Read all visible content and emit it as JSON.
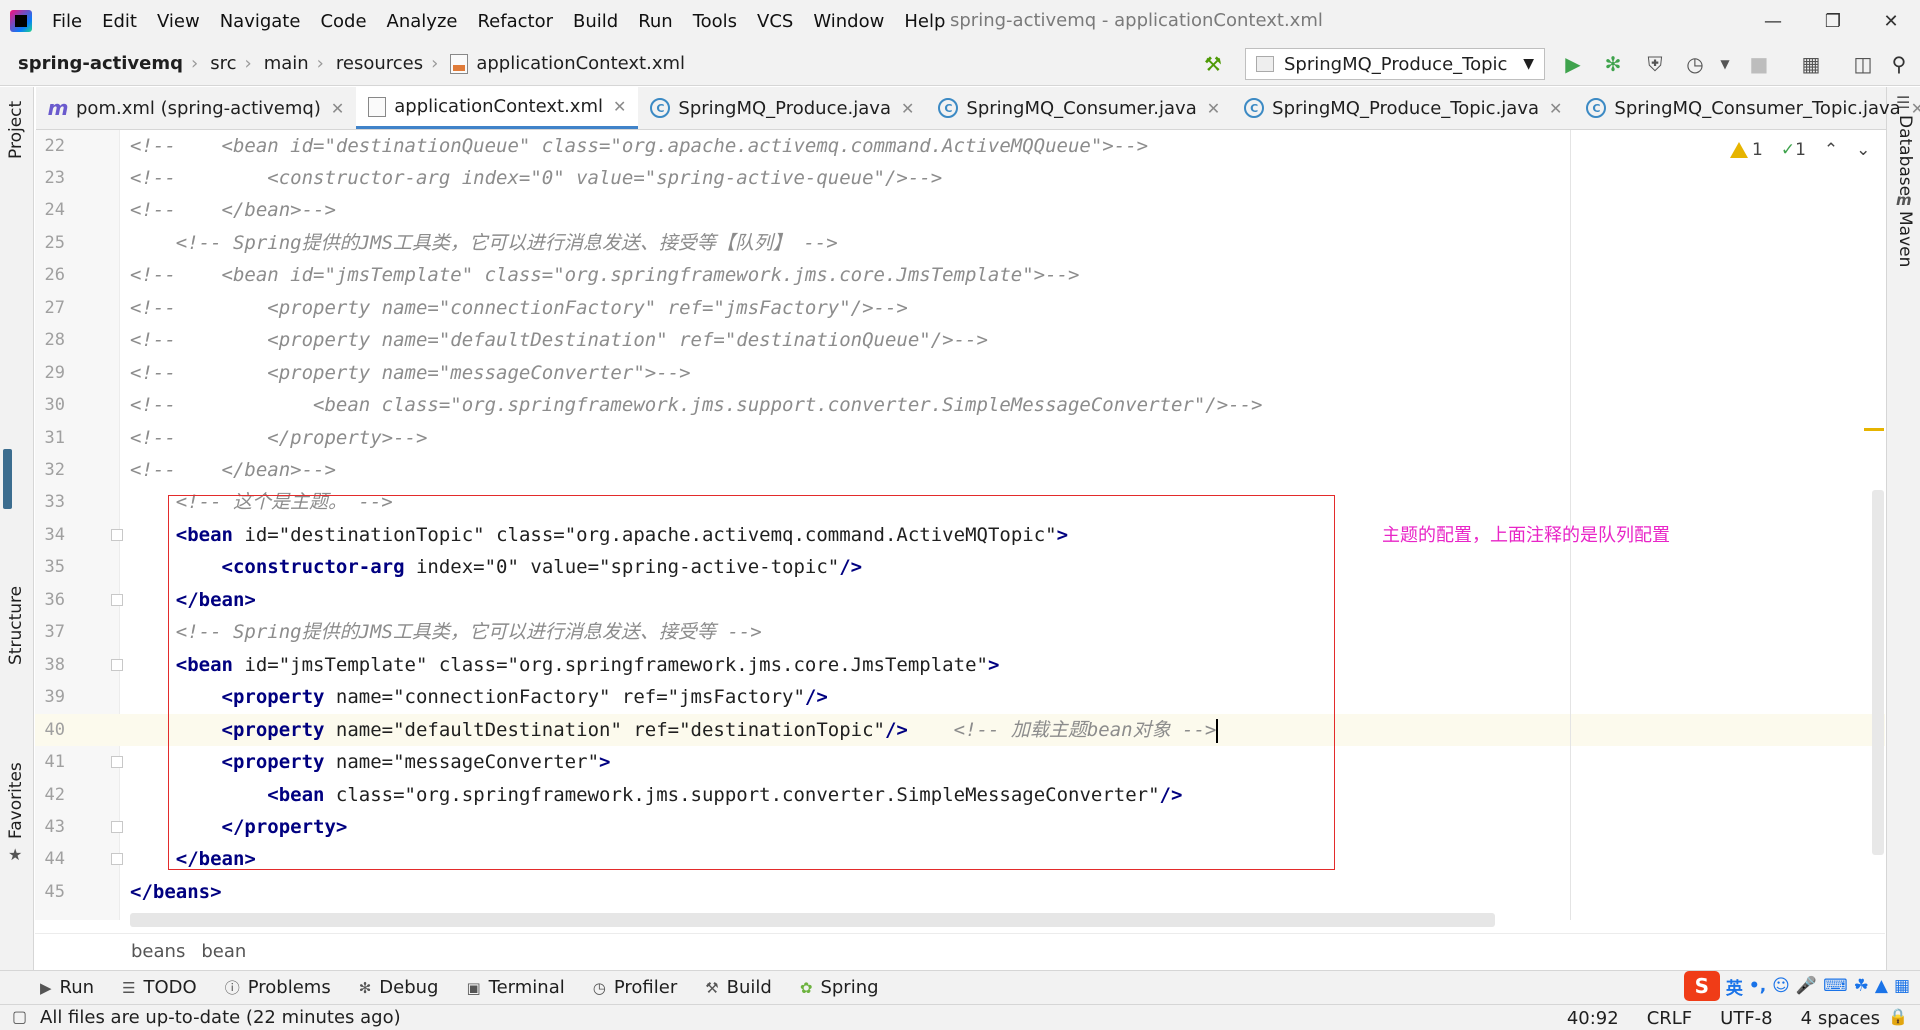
{
  "app": {
    "window_title": "spring-activemq - applicationContext.xml",
    "menu": [
      "File",
      "Edit",
      "View",
      "Navigate",
      "Code",
      "Analyze",
      "Refactor",
      "Build",
      "Run",
      "Tools",
      "VCS",
      "Window",
      "Help"
    ]
  },
  "navbar": {
    "breadcrumbs": [
      "spring-activemq",
      "src",
      "main",
      "resources",
      "applicationContext.xml"
    ],
    "run_config": "SpringMQ_Produce_Topic"
  },
  "tabs": [
    {
      "label": "pom.xml (spring-activemq)",
      "icon": "maven-icon",
      "active": false
    },
    {
      "label": "applicationContext.xml",
      "icon": "xml-file-icon",
      "active": true
    },
    {
      "label": "SpringMQ_Produce.java",
      "icon": "java-class-icon",
      "active": false
    },
    {
      "label": "SpringMQ_Consumer.java",
      "icon": "java-class-icon",
      "active": false
    },
    {
      "label": "SpringMQ_Produce_Topic.java",
      "icon": "java-class-icon",
      "active": false
    },
    {
      "label": "SpringMQ_Consumer_Topic.java",
      "icon": "java-class-icon",
      "active": false
    }
  ],
  "side_panels": {
    "left": [
      "Project",
      "Structure",
      "Favorites"
    ],
    "right": [
      "Database",
      "Maven"
    ]
  },
  "inspections": {
    "warnings": "1",
    "weak_warnings": "1"
  },
  "editor": {
    "lines": [
      {
        "n": "22",
        "text": "<!--    <bean id=\"destinationQueue\" class=\"org.apache.activemq.command.ActiveMQQueue\">-->"
      },
      {
        "n": "23",
        "text": "<!--        <constructor-arg index=\"0\" value=\"spring-active-queue\"/>-->"
      },
      {
        "n": "24",
        "text": "<!--    </bean>-->"
      },
      {
        "n": "25",
        "text": "    <!-- Spring提供的JMS工具类，它可以进行消息发送、接受等【队列】 -->"
      },
      {
        "n": "26",
        "text": "<!--    <bean id=\"jmsTemplate\" class=\"org.springframework.jms.core.JmsTemplate\">-->"
      },
      {
        "n": "27",
        "text": "<!--        <property name=\"connectionFactory\" ref=\"jmsFactory\"/>-->"
      },
      {
        "n": "28",
        "text": "<!--        <property name=\"defaultDestination\" ref=\"destinationQueue\"/>-->"
      },
      {
        "n": "29",
        "text": "<!--        <property name=\"messageConverter\">-->"
      },
      {
        "n": "30",
        "text": "<!--            <bean class=\"org.springframework.jms.support.converter.SimpleMessageConverter\"/>-->"
      },
      {
        "n": "31",
        "text": "<!--        </property>-->"
      },
      {
        "n": "32",
        "text": "<!--    </bean>-->"
      },
      {
        "n": "33",
        "text": "    <!-- 这个是主题。 -->"
      },
      {
        "n": "34",
        "text": "    <bean id=\"destinationTopic\" class=\"org.apache.activemq.command.ActiveMQTopic\">"
      },
      {
        "n": "35",
        "text": "        <constructor-arg index=\"0\" value=\"spring-active-topic\"/>"
      },
      {
        "n": "36",
        "text": "    </bean>"
      },
      {
        "n": "37",
        "text": "    <!-- Spring提供的JMS工具类，它可以进行消息发送、接受等 -->"
      },
      {
        "n": "38",
        "text": "    <bean id=\"jmsTemplate\" class=\"org.springframework.jms.core.JmsTemplate\">"
      },
      {
        "n": "39",
        "text": "        <property name=\"connectionFactory\" ref=\"jmsFactory\"/>"
      },
      {
        "n": "40",
        "text": "        <property name=\"defaultDestination\" ref=\"destinationTopic\"/>    <!-- 加载主题bean对象 -->"
      },
      {
        "n": "41",
        "text": "        <property name=\"messageConverter\">"
      },
      {
        "n": "42",
        "text": "            <bean class=\"org.springframework.jms.support.converter.SimpleMessageConverter\"/>"
      },
      {
        "n": "43",
        "text": "        </property>"
      },
      {
        "n": "44",
        "text": "    </bean>"
      },
      {
        "n": "45",
        "text": "</beans>"
      }
    ],
    "annotation": "主题的配置，上面注释的是队列配置",
    "crumbs": [
      "beans",
      "bean"
    ]
  },
  "tool_windows": [
    "Run",
    "TODO",
    "Problems",
    "Debug",
    "Terminal",
    "Profiler",
    "Build",
    "Spring"
  ],
  "ime": {
    "mode": "英"
  },
  "status": {
    "message": "All files are up-to-date (22 minutes ago)",
    "position": "40:92",
    "line_separator": "CRLF",
    "encoding": "UTF-8",
    "indent": "4 spaces"
  },
  "colors": {
    "highlight_box": "#e32b2b",
    "annotation": "#e825c7",
    "comment": "#8c8c8c",
    "tag": "#000080",
    "attribute": "#0000ff",
    "value": "#008000"
  }
}
